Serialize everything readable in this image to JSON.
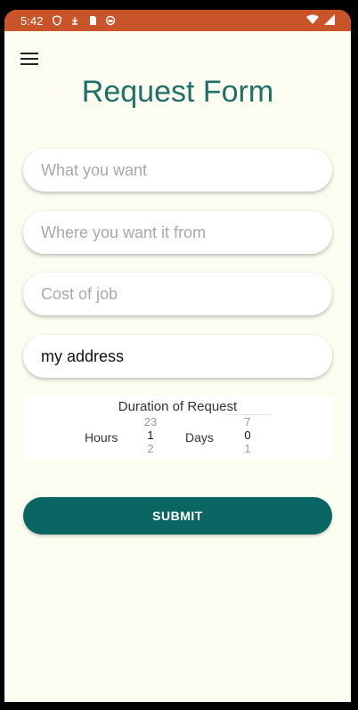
{
  "status_bar": {
    "time": "5:42",
    "color": "#c9542a"
  },
  "header": {
    "title": "Request Form"
  },
  "form": {
    "fields": [
      {
        "placeholder": "What you want",
        "value": ""
      },
      {
        "placeholder": "Where you want it from",
        "value": ""
      },
      {
        "placeholder": "Cost of job",
        "value": ""
      },
      {
        "placeholder": "",
        "value": "my address"
      }
    ]
  },
  "duration": {
    "label": "Duration of Request",
    "hours_label": "Hours",
    "days_label": "Days",
    "hours_prev": "23",
    "hours_current": "1",
    "hours_next": "2",
    "days_prev": "7",
    "days_current": "0",
    "days_next": "1"
  },
  "submit": {
    "label": "SUBMIT",
    "color": "#096662"
  },
  "colors": {
    "background": "#fcfcf1",
    "title": "#1f6f66"
  }
}
